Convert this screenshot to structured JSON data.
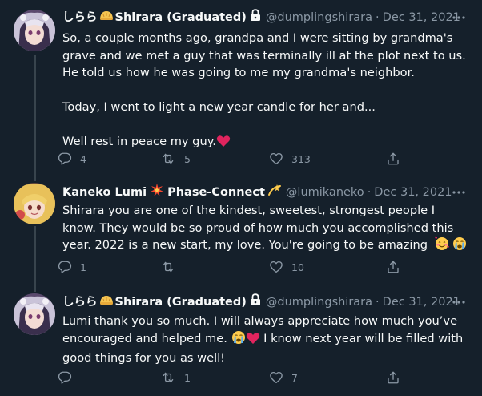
{
  "colors": {
    "background": "#15202b",
    "text": "#f7f9f9",
    "secondary_text": "#8b98a5",
    "divider": "#38444d",
    "heart": "#e0245e"
  },
  "icons": {
    "reply": "reply-icon",
    "retweet": "retweet-icon",
    "like": "heart-outline-icon",
    "share": "share-icon",
    "more": "more-icon",
    "lock": "lock-icon"
  },
  "tweets": [
    {
      "display_name": "しらら",
      "display_name_suffix": "Shirara (Graduated)",
      "handle": "@dumplingshirara",
      "separator": "·",
      "date": "Dec 31, 2021",
      "paragraphs": [
        "So, a couple months ago, grandpa and I were sitting by grandma's grave and we met a guy that was terminally ill at the plot next to us. He told us how he was going to me my grandma's neighbor.",
        "Today, I went to light a new year candle for her and...",
        "Well rest in peace my guy."
      ],
      "reply_count": "4",
      "retweet_count": "5",
      "like_count": "313"
    },
    {
      "display_name": "Kaneko Lumi",
      "display_name_suffix": "Phase-Connect",
      "handle": "@lumikaneko",
      "separator": "·",
      "date": "Dec 31, 2021",
      "text": "Shirara you are one of the kindest, sweetest, strongest people I know. They would be so proud of how much you accomplished this year. 2022 is a new start, my love. You're going to be amazing",
      "reply_count": "1",
      "retweet_count": "",
      "like_count": "10"
    },
    {
      "display_name": "しらら",
      "display_name_suffix": "Shirara (Graduated)",
      "handle": "@dumplingshirara",
      "separator": "·",
      "date": "Dec 31, 2021",
      "text_part1": "Lumi thank you so much. I will always appreciate how much you’ve encouraged and helped me.",
      "text_part2": "I know next year will be filled with good things for you as well!",
      "reply_count": "",
      "retweet_count": "1",
      "like_count": "7"
    }
  ]
}
